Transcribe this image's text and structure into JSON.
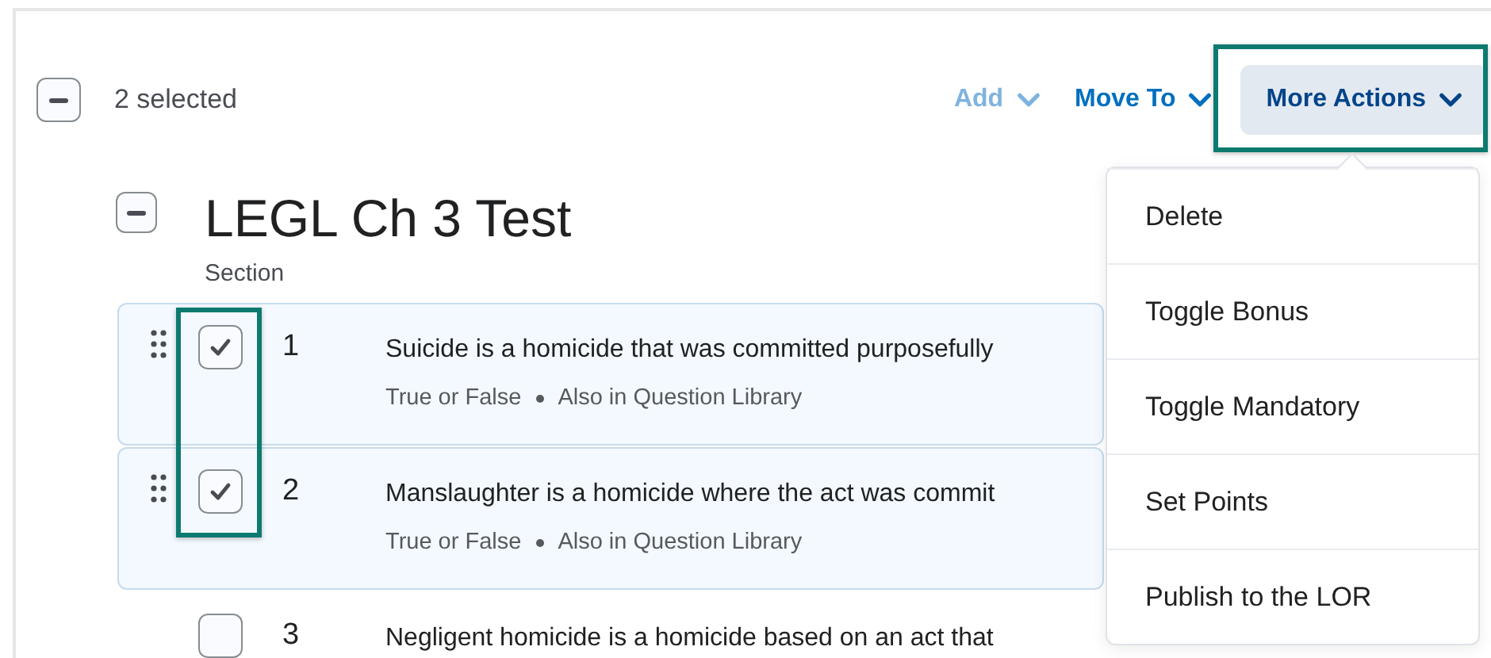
{
  "selection": {
    "label": "2 selected"
  },
  "toolbar": [
    {
      "label": "Add",
      "disabled": true,
      "pressed": false
    },
    {
      "label": "Move To",
      "disabled": false,
      "pressed": false
    },
    {
      "label": "More Actions",
      "disabled": false,
      "pressed": true
    }
  ],
  "section": {
    "title": "LEGL Ch 3 Test",
    "caption": "Section"
  },
  "questions": [
    {
      "number": "1",
      "text": "Suicide is a homicide that was committed purposefully",
      "type": "True or False",
      "library": "Also in Question Library",
      "checked": true
    },
    {
      "number": "2",
      "text": "Manslaughter is a homicide where the act was commit",
      "type": "True or False",
      "library": "Also in Question Library",
      "checked": true
    },
    {
      "number": "3",
      "text": "Negligent homicide is a homicide based on an act that",
      "checked": false
    }
  ],
  "menu": [
    {
      "label": "Delete"
    },
    {
      "label": "Toggle Bonus"
    },
    {
      "label": "Toggle Mandatory"
    },
    {
      "label": "Set Points"
    },
    {
      "label": "Publish to the LOR"
    }
  ]
}
